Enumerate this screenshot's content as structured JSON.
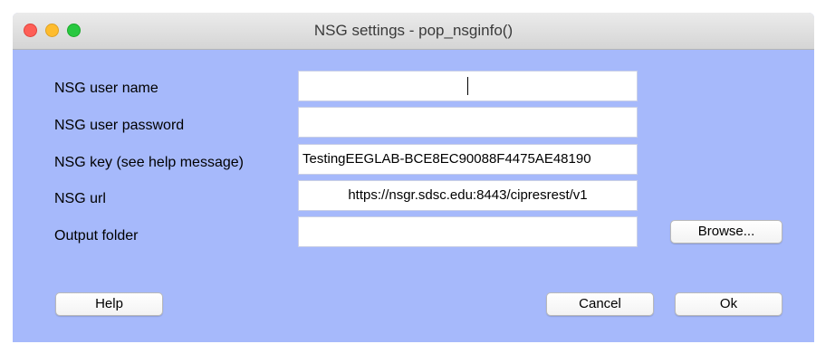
{
  "window": {
    "title": "NSG settings - pop_nsginfo()"
  },
  "form": {
    "user_name": {
      "label": "NSG user name",
      "value": ""
    },
    "user_password": {
      "label": "NSG user password",
      "value": ""
    },
    "key": {
      "label": "NSG key (see help message)",
      "value": "TestingEEGLAB-BCE8EC90088F4475AE48190"
    },
    "url": {
      "label": "NSG url",
      "value": "https://nsgr.sdsc.edu:8443/cipresrest/v1"
    },
    "output_folder": {
      "label": "Output folder",
      "value": ""
    }
  },
  "buttons": {
    "browse": "Browse...",
    "help": "Help",
    "cancel": "Cancel",
    "ok": "Ok"
  },
  "colors": {
    "dialog_background": "#a6b9fb",
    "close": "#fe5f57",
    "minimize": "#febc2e",
    "maximize": "#28c840"
  }
}
